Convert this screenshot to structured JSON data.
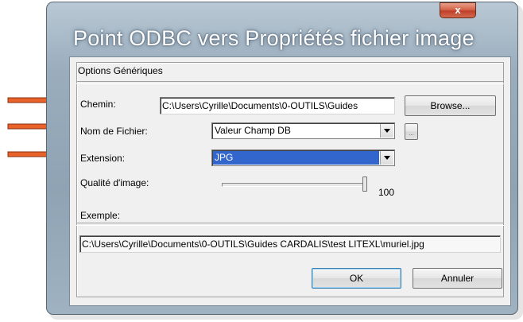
{
  "window": {
    "title": "Point ODBC vers Propriétés fichier image",
    "close_label": "x"
  },
  "group": {
    "title": "Options Génériques"
  },
  "fields": {
    "chemin": {
      "label": "Chemin:",
      "value": "C:\\Users\\Cyrille\\Documents\\0-OUTILS\\Guides"
    },
    "browse_label": "Browse...",
    "nom_fichier": {
      "label": "Nom de Fichier:",
      "selected": "Valeur Champ DB",
      "extra_button": "..."
    },
    "extension": {
      "label": "Extension:",
      "selected": "JPG"
    },
    "qualite": {
      "label": "Qualité d'image:",
      "value": "100",
      "level": 1.0
    }
  },
  "example": {
    "label": "Exemple:",
    "value": "C:\\Users\\Cyrille\\Documents\\0-OUTILS\\Guides CARDALIS\\test LITEXL\\muriel.jpg"
  },
  "buttons": {
    "ok": "OK",
    "cancel": "Annuler"
  },
  "colors": {
    "arrow": "#e8622a",
    "selection": "#3366cc"
  }
}
